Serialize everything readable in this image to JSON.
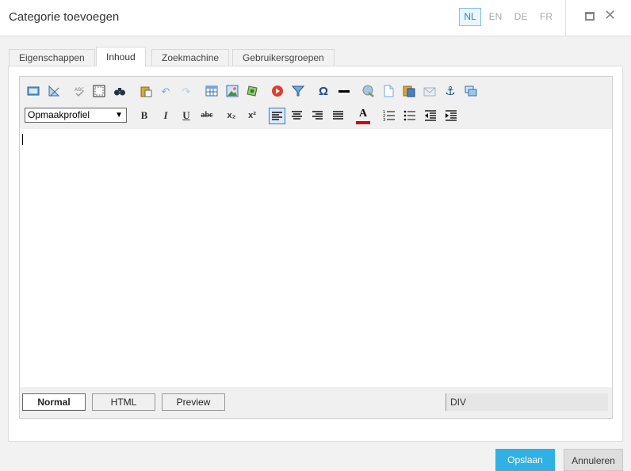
{
  "dialog": {
    "title": "Categorie toevoegen"
  },
  "languages": [
    {
      "code": "NL",
      "active": true
    },
    {
      "code": "EN",
      "active": false
    },
    {
      "code": "DE",
      "active": false
    },
    {
      "code": "FR",
      "active": false
    }
  ],
  "tabs": [
    {
      "label": "Eigenschappen",
      "active": false
    },
    {
      "label": "Inhoud",
      "active": true
    },
    {
      "label": "Zoekmachine",
      "active": false
    },
    {
      "label": "Gebruikersgroepen",
      "active": false
    }
  ],
  "toolbar": {
    "style_select": "Opmaakprofiel",
    "row1_icons": [
      "fullscreen-icon",
      "image-manager-icon",
      "spellcheck-icon",
      "select-all-icon",
      "find-icon",
      "paste-icon",
      "undo-icon",
      "redo-icon",
      "table-icon",
      "insert-image-icon",
      "media-icon",
      "flash-icon",
      "filter-icon",
      "special-char-icon",
      "horizontal-rule-icon",
      "hyperlink-icon",
      "template-icon",
      "paste-word-icon",
      "email-link-icon",
      "anchor-icon",
      "layers-icon"
    ],
    "row2_icons": [
      "bold-icon",
      "italic-icon",
      "underline-icon",
      "strikethrough-icon",
      "subscript-icon",
      "superscript-icon",
      "align-left-icon",
      "align-center-icon",
      "align-right-icon",
      "justify-icon",
      "font-color-icon",
      "ordered-list-icon",
      "unordered-list-icon",
      "outdent-icon",
      "indent-icon"
    ],
    "bold": "B",
    "italic": "I",
    "underline": "U",
    "strike": "abc",
    "subscript": "x₂",
    "superscript": "x²",
    "omega": "Ω",
    "font_color": "A"
  },
  "modes": [
    {
      "label": "Normal",
      "active": true
    },
    {
      "label": "HTML",
      "active": false
    },
    {
      "label": "Preview",
      "active": false
    }
  ],
  "path": "DIV",
  "footer": {
    "save": "Opslaan",
    "cancel": "Annuleren"
  },
  "colors": {
    "accent": "#2fb1e5",
    "lang_active": "#2e86c1",
    "font_color_bar": "#d0021b"
  }
}
